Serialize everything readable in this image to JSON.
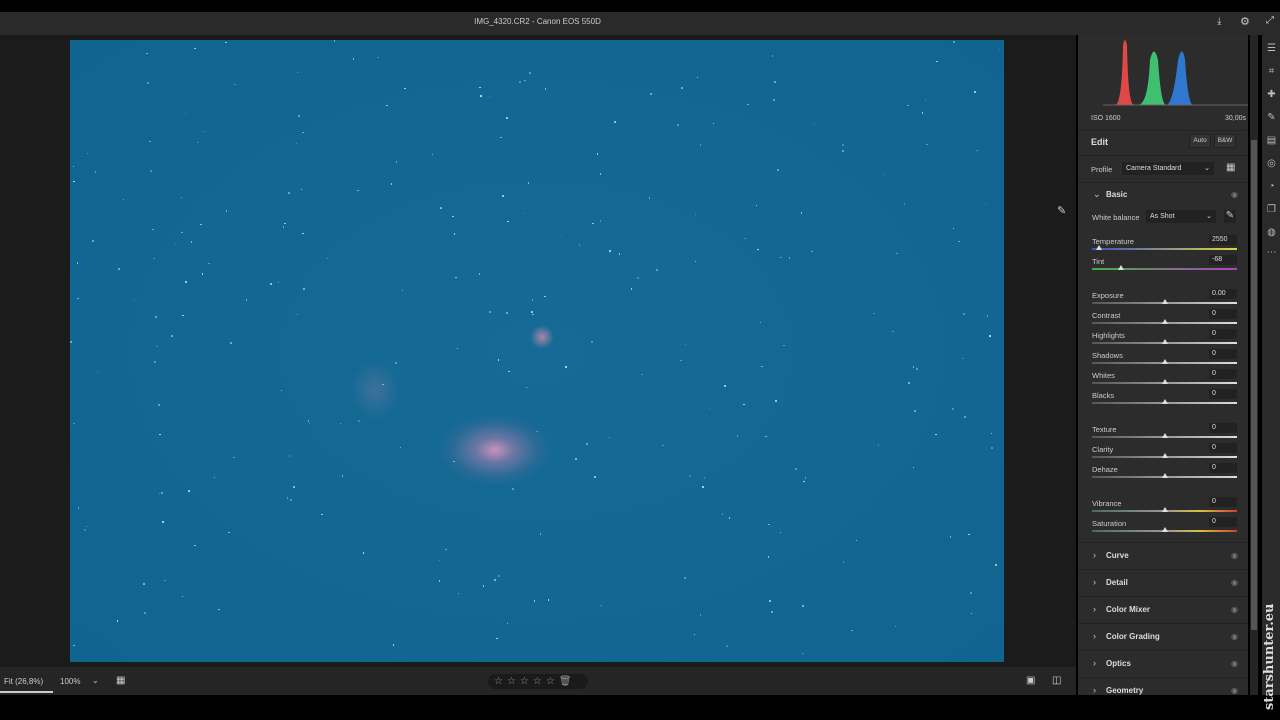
{
  "title": "IMG_4320.CR2  -  Canon EOS 550D",
  "histogram": {
    "iso": "ISO 1600",
    "shutter": "30,00s"
  },
  "edit": {
    "label": "Edit",
    "auto": "Auto",
    "bw": "B&W"
  },
  "profile": {
    "label": "Profile",
    "value": "Camera Standard"
  },
  "basic": {
    "label": "Basic",
    "wb_label": "White balance",
    "wb_value": "As Shot",
    "sliders": [
      {
        "label": "Temperature",
        "value": "2550",
        "pos": 0.05
      },
      {
        "label": "Tint",
        "value": "-68",
        "pos": 0.2
      },
      {
        "label": "Exposure",
        "value": "0.00",
        "pos": 0.5
      },
      {
        "label": "Contrast",
        "value": "0",
        "pos": 0.5
      },
      {
        "label": "Highlights",
        "value": "0",
        "pos": 0.5
      },
      {
        "label": "Shadows",
        "value": "0",
        "pos": 0.5
      },
      {
        "label": "Whites",
        "value": "0",
        "pos": 0.5
      },
      {
        "label": "Blacks",
        "value": "0",
        "pos": 0.5
      },
      {
        "label": "Texture",
        "value": "0",
        "pos": 0.5
      },
      {
        "label": "Clarity",
        "value": "0",
        "pos": 0.5
      },
      {
        "label": "Dehaze",
        "value": "0",
        "pos": 0.5
      },
      {
        "label": "Vibrance",
        "value": "0",
        "pos": 0.5
      },
      {
        "label": "Saturation",
        "value": "0",
        "pos": 0.5
      }
    ]
  },
  "sections": [
    "Curve",
    "Detail",
    "Color Mixer",
    "Color Grading",
    "Optics",
    "Geometry"
  ],
  "bottom": {
    "fit": "Fit (26,8%)",
    "zoom": "100%"
  },
  "watermark": "starshunter.eu"
}
